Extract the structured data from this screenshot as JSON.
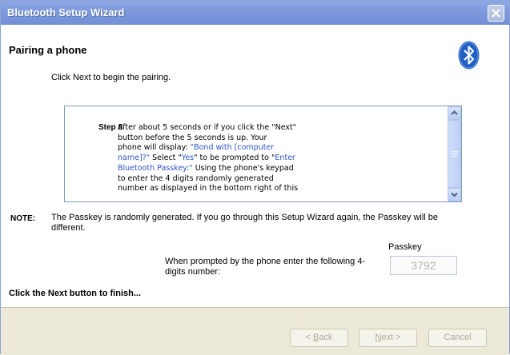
{
  "window": {
    "title": "Bluetooth Setup Wizard"
  },
  "header": {
    "title": "Pairing a phone",
    "subtitle": "Click Next to begin the pairing."
  },
  "step": {
    "label": "Step 8",
    "line1": "After about 5 seconds or if you click the \"Next\"",
    "line2": "button before the 5 seconds is up. Your",
    "line3a": "phone will display: ",
    "line3b": "\"Bond with [computer",
    "line4a": "name]?\"",
    "line4b": "   Select \"",
    "line4c": "Yes",
    "line4d": "\" to be prompted to \"",
    "line4e": "Enter",
    "line5a": "Bluetooth Passkey:\"",
    "line5b": " Using the phone's keypad",
    "line6": "to enter the 4 digits randomly generated",
    "line7": "number as displayed in the bottom right of this"
  },
  "note": {
    "label": "NOTE:",
    "text": "The Passkey is randomly generated.  If you go through this Setup Wizard again, the Passkey will be different."
  },
  "passkey": {
    "label": "Passkey",
    "prompt": "When prompted by the phone enter the following 4-digits number:",
    "value": "3792"
  },
  "finish_text": "Click the Next button to finish...",
  "buttons": {
    "back_pre": "< ",
    "back_key": "B",
    "back_post": "ack",
    "next_key": "N",
    "next_post": "ext >",
    "cancel": "Cancel"
  },
  "colors": {
    "titlebar": "#7d99dc",
    "link_blue": "#2e56c7",
    "disabled_text": "#aca899"
  }
}
